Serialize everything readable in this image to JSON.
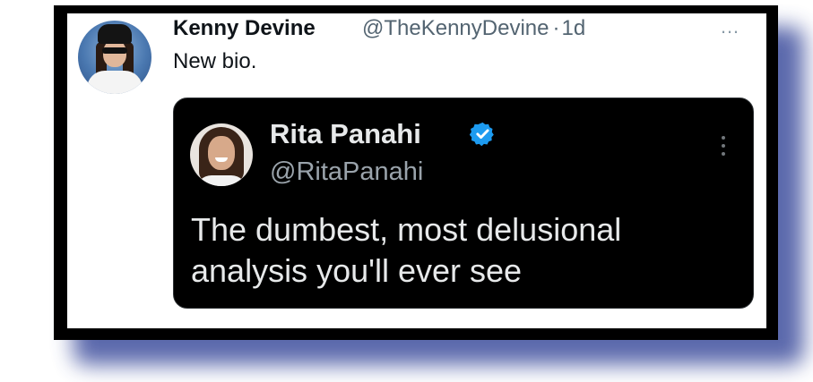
{
  "tweet": {
    "author_name": "Kenny Devine",
    "handle": "@TheKennyDevine",
    "separator": "·",
    "time": "1d",
    "text": "New bio.",
    "more_icon": "…"
  },
  "quoted_tweet": {
    "author_name": "Rita Panahi",
    "handle": "@RitaPanahi",
    "verified": true,
    "text": "The dumbest, most delusional analysis you'll ever see"
  },
  "colors": {
    "frame": "#000000",
    "shadow": "#3f4f9e",
    "verified_badge": "#1d9bf0",
    "quote_background": "#000000"
  }
}
